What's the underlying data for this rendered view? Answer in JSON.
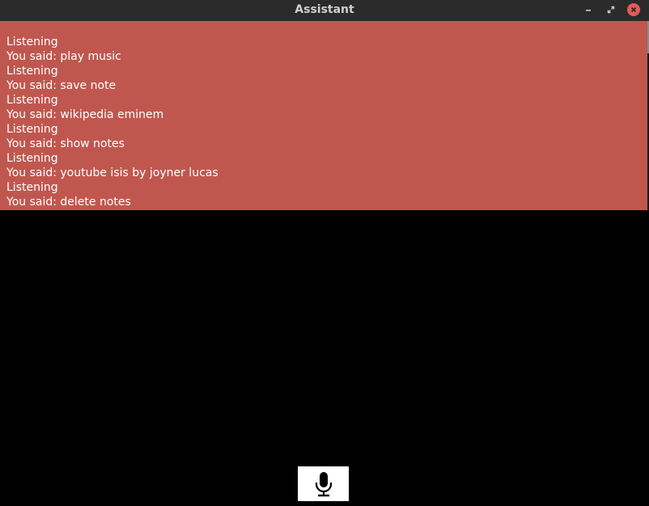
{
  "window": {
    "title": "Assistant",
    "controls": {
      "minimize_icon": "minimize-icon",
      "maximize_icon": "maximize-icon",
      "close_icon": "close-icon",
      "close_color": "#e25b5b"
    }
  },
  "log": {
    "background": "#c0574f",
    "lines": [
      "Listening",
      "You said: play music",
      "Listening",
      "You said: save note",
      "Listening",
      "You said: wikipedia eminem",
      "Listening",
      "You said: show notes",
      "Listening",
      "You said: youtube isis by joyner lucas",
      "Listening",
      "You said: delete notes"
    ]
  },
  "mic": {
    "icon": "microphone-icon"
  }
}
